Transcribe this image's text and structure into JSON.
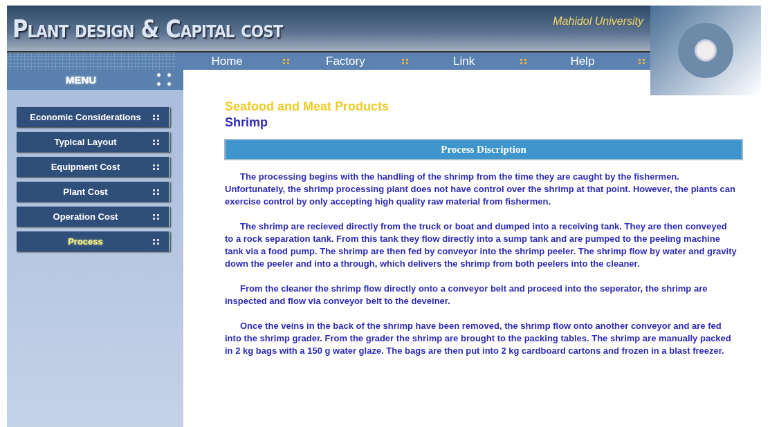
{
  "header": {
    "title": "Plant design & Capital cost",
    "university": "Mahidol University"
  },
  "nav": [
    {
      "label": "Home"
    },
    {
      "label": "Factory"
    },
    {
      "label": "Link"
    },
    {
      "label": "Help"
    }
  ],
  "menu": {
    "title": "MENU",
    "items": [
      {
        "label": "Economic Considerations",
        "selected": false
      },
      {
        "label": "Typical Layout",
        "selected": false
      },
      {
        "label": "Equipment Cost",
        "selected": false
      },
      {
        "label": "Plant Cost",
        "selected": false
      },
      {
        "label": "Operation Cost",
        "selected": false
      },
      {
        "label": "Process",
        "selected": true
      }
    ]
  },
  "content": {
    "category": "Seafood and Meat Products",
    "heading": "Shrimp",
    "section_title": "Process Discription",
    "paragraphs": [
      "The processing begins with the handling of the shrimp from the time they are caught by the fishermen. Unfortunately, the shrimp processing plant does not have control over the shrimp at that point. However, the plants can exercise control by only accepting high quality raw material from fishermen.",
      "The shrimp are recieved directly from the truck or boat and dumped into a receiving tank. They are then conveyed to a rock separation tank. From this tank they flow directly into a sump tank and are pumped to the peeling machine tank via a food pump. The shrimp are then fed by conveyor into the shrimp peeler. The shrimp flow by water and gravity down the peeler and into a through, which delivers the shrimp from both peelers into the cleaner.",
      "From the cleaner the shrimp flow directly onto a conveyor belt and proceed into the seperator, the shrimp are inspected and flow via conveyor belt to the deveiner.",
      "Once the veins in the back of the shrimp have been removed, the shrimp flow onto another conveyor and are fed into the shrimp grader. From the grader the shrimp are brought to the packing tables. The shrimp are manually packed in 2 kg bags with a 150 g water glaze. The bags are then put into 2 kg cardboard cartons and frozen in a blast freezer."
    ]
  }
}
